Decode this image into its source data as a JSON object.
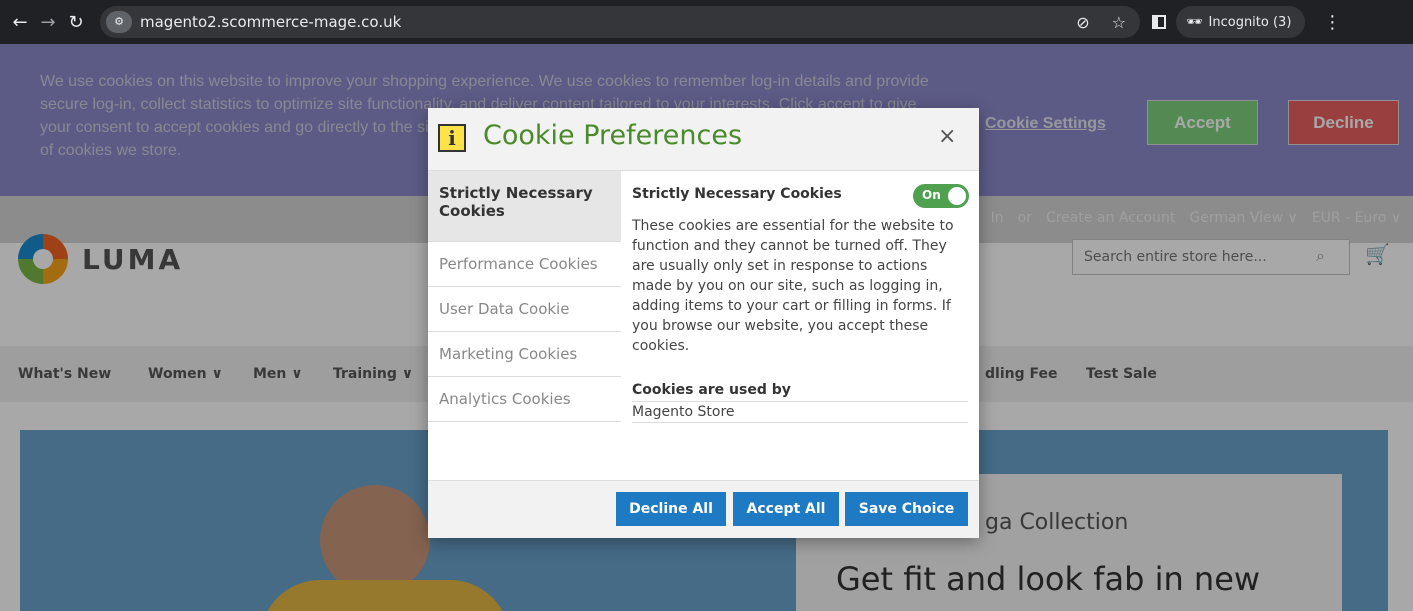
{
  "browser": {
    "url": "magento2.scommerce-mage.co.uk",
    "incognito_label": "Incognito (3)",
    "icons": [
      "back-arrow-icon",
      "forward-arrow-icon",
      "reload-icon",
      "site-info-icon",
      "eye-off-icon",
      "star-icon",
      "side-panel-icon",
      "incognito-icon",
      "more-vert-icon"
    ]
  },
  "cookie_bar": {
    "text": "We use cookies on this website to improve your shopping experience. We use cookies to remember log-in details and provide secure log-in, collect statistics to optimize site functionality, and deliver content tailored to your interests. Click accept to give your consent to accept cookies and go directly to the site or click on more information to see detailed descriptions of the types of cookies we store.",
    "settings_link": "Cookie Settings",
    "accept": "Accept",
    "decline": "Decline"
  },
  "top_links": {
    "sign_in": "In",
    "or": "or",
    "create": "Create an Account",
    "store_view": "German View ∨",
    "currency": "EUR - Euro ∨"
  },
  "header": {
    "logo": "LUMA",
    "search_placeholder": "Search entire store here..."
  },
  "menu": {
    "whats_new": "What's New",
    "women": "Women ∨",
    "men": "Men ∨",
    "training": "Training ∨",
    "handling": "dling Fee",
    "test_sale": "Test Sale"
  },
  "hero": {
    "collection": "ga Collection",
    "headline": "Get fit and look fab in new"
  },
  "modal": {
    "title": "Cookie Preferences",
    "close": "×",
    "tabs": [
      {
        "label": "Strictly Necessary Cookies"
      },
      {
        "label": "Performance Cookies"
      },
      {
        "label": "User Data Cookie"
      },
      {
        "label": "Marketing Cookies"
      },
      {
        "label": "Analytics Cookies"
      }
    ],
    "section_title": "Strictly Necessary Cookies",
    "toggle_label": "On",
    "description": "These cookies are essential for the website to function and they cannot be turned off. They are usually only set in response to actions made by you on our site, such as logging in, adding items to your cart or filling in forms. If you browse our website, you accept these cookies.",
    "used_by_title": "Cookies are used by",
    "used_by_value": "Magento Store",
    "buttons": {
      "decline_all": "Decline All",
      "accept_all": "Accept All",
      "save_choice": "Save Choice"
    }
  },
  "colors": {
    "accent_blue": "#1f7ac4",
    "title_green": "#4a8a2a",
    "toggle_green": "#4fa04f"
  }
}
